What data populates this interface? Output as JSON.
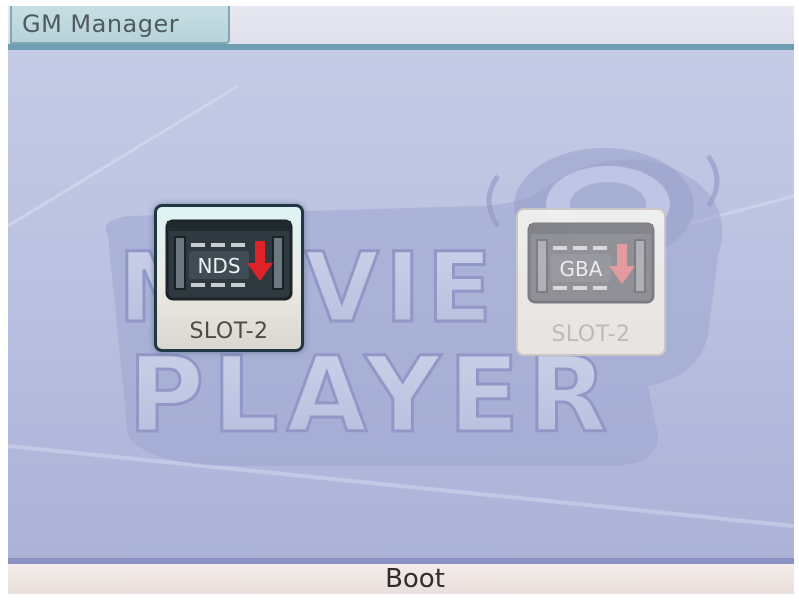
{
  "window": {
    "title": "GM Manager"
  },
  "background": {
    "logo_line1": "MOVIE",
    "logo_line2": "PLAYER"
  },
  "slots": [
    {
      "cart_label": "NDS",
      "label": "SLOT-2",
      "selected": true,
      "icon": "nds-cartridge-icon"
    },
    {
      "cart_label": "GBA",
      "label": "SLOT-2",
      "selected": false,
      "icon": "gba-cartridge-icon"
    }
  ],
  "bottombar": {
    "boot_label": "Boot"
  },
  "colors": {
    "accent": "#6f9db2",
    "download_arrow": "#e0232b",
    "bottom_border": "#8b92c4"
  }
}
